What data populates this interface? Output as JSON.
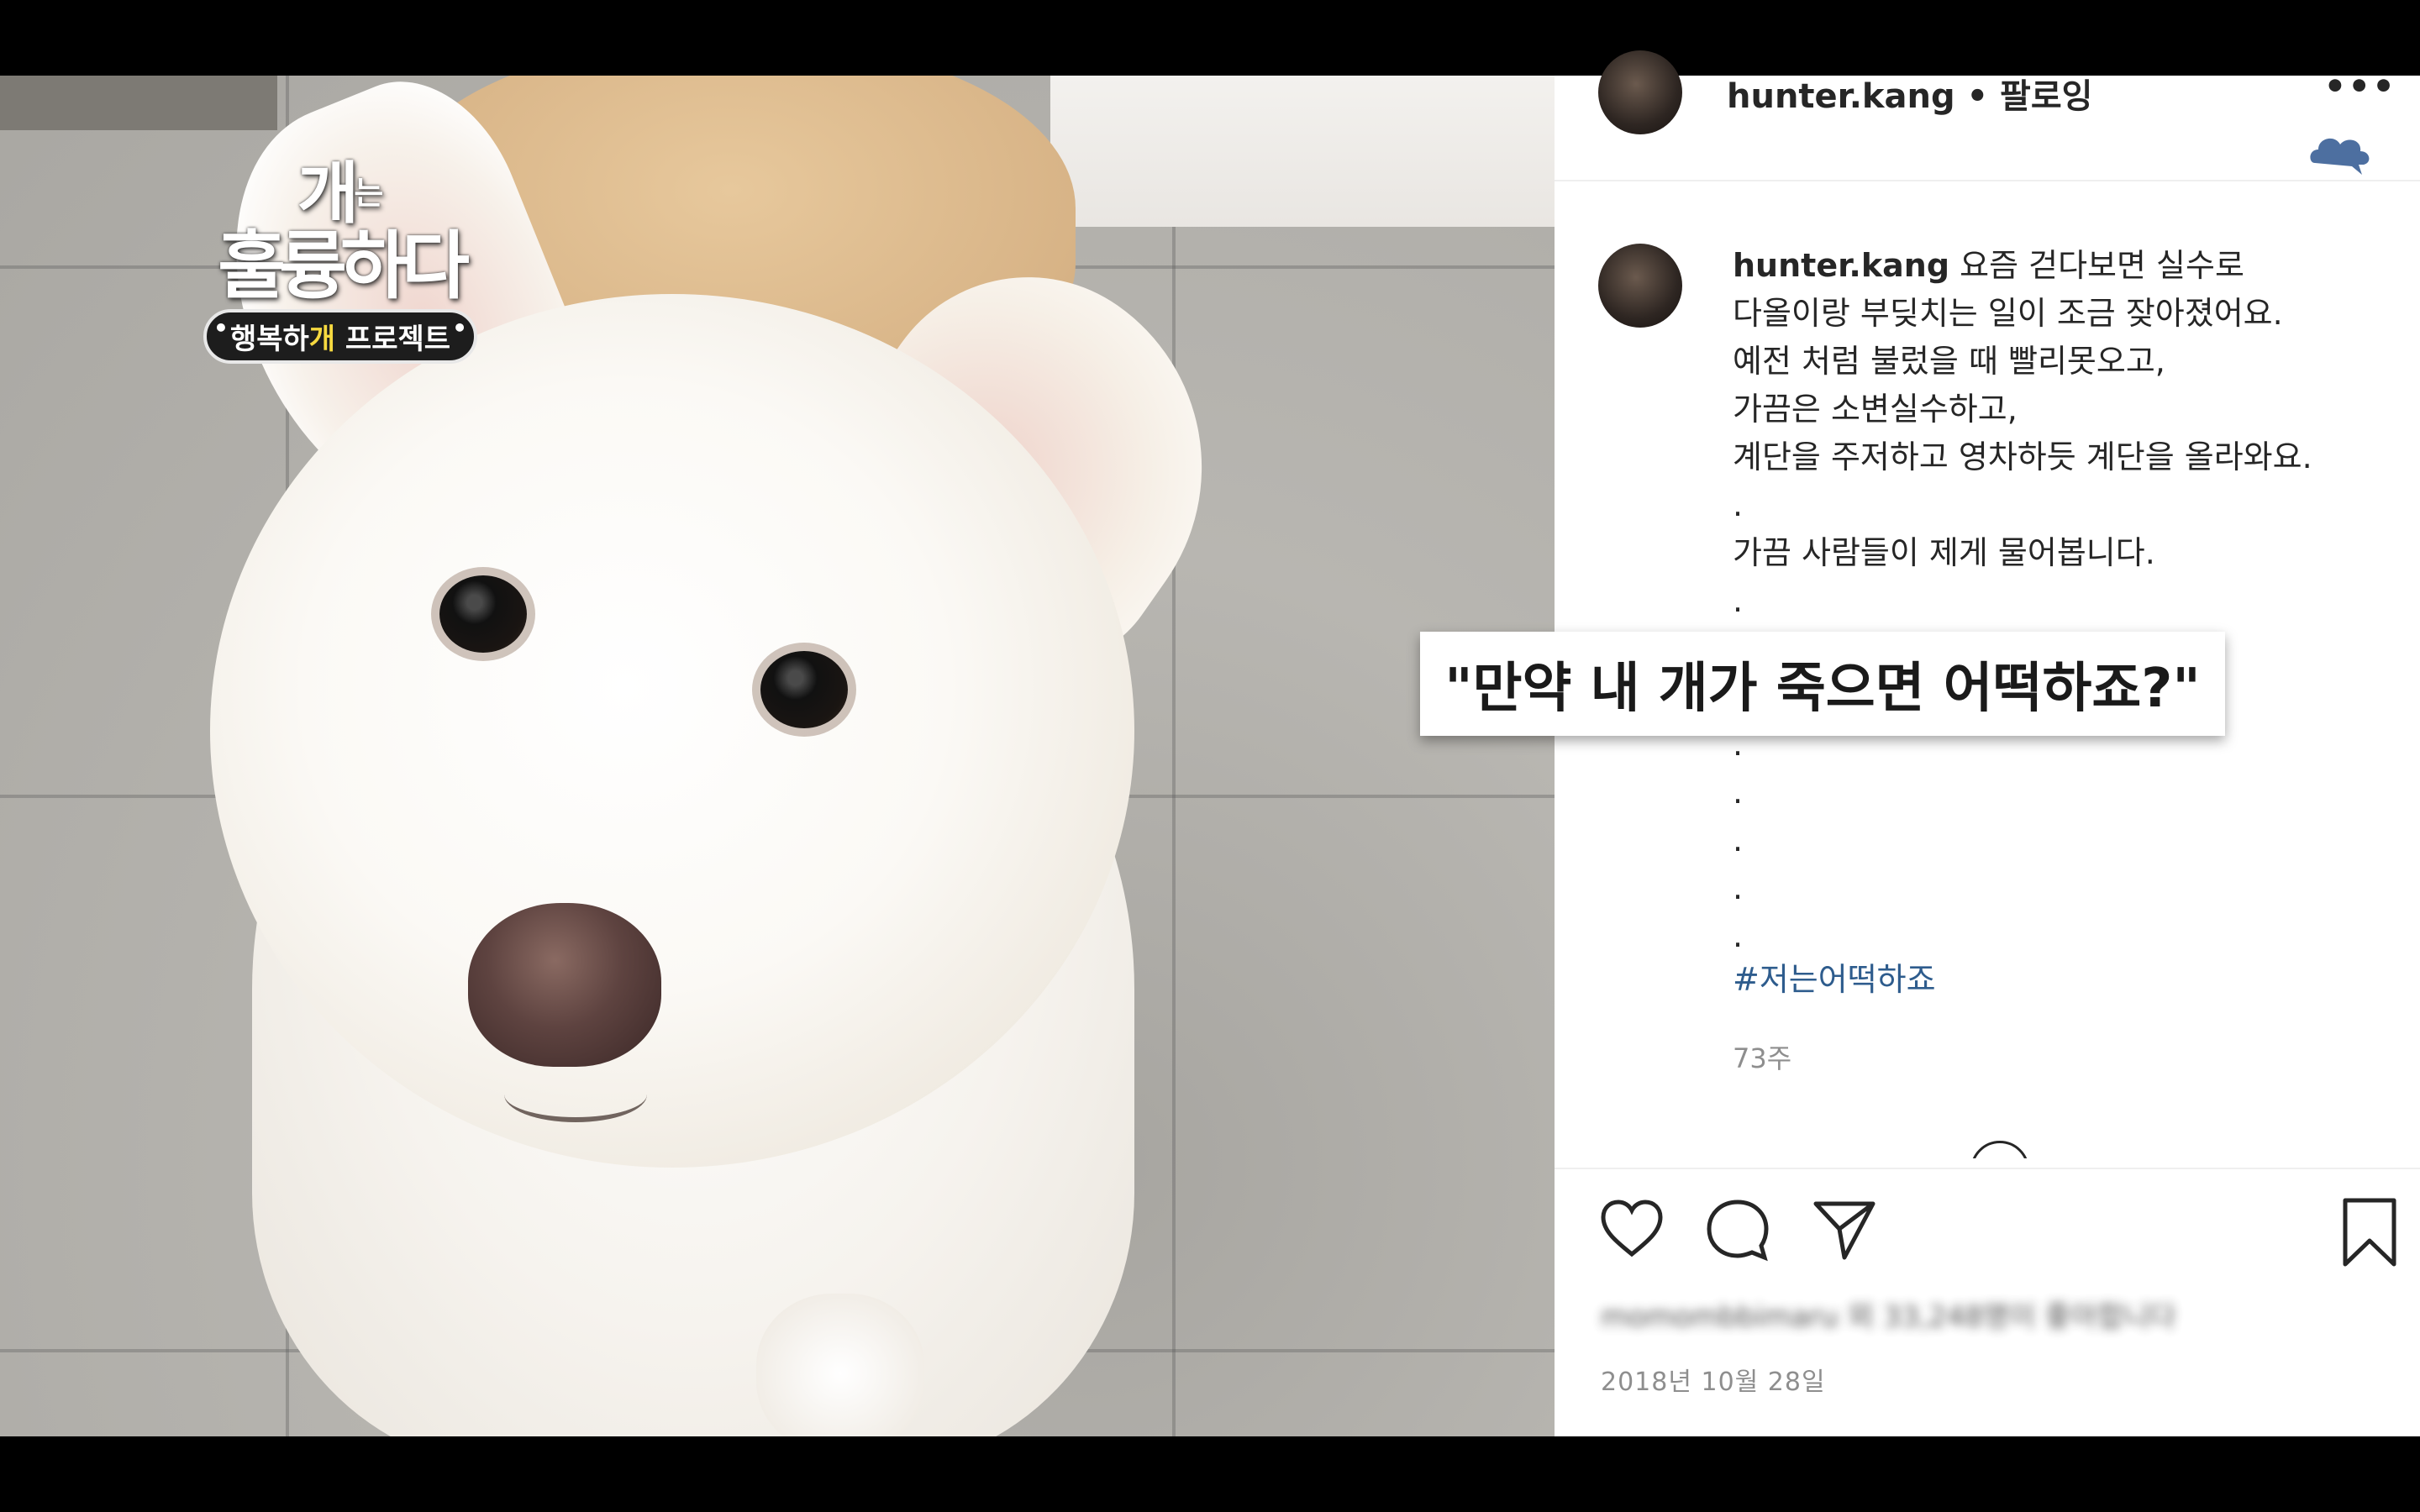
{
  "show": {
    "title_line1": "개",
    "title_small": "는",
    "title_line2": "훌륭하다",
    "subtitle_pre": "행복하",
    "subtitle_highlight": "개",
    "subtitle_post": " 프로젝트"
  },
  "post": {
    "header_username": "hunter.kang",
    "header_follow": " • 팔로잉",
    "more_label": "•••",
    "caption_username": "hunter.kang",
    "caption_lines": [
      " 요즘 걷다보면 실수로",
      "다올이랑 부딪치는 일이 조금 잦아졌어요.",
      "예전 처럼 불렀을 때 빨리못오고,",
      "가끔은 소변실수하고,",
      "계단을 주저하고 영차하듯 계단을 올라와요.",
      ".",
      "가끔 사람들이 제게 물어봅니다.",
      ".",
      ".",
      ".",
      ".",
      ".",
      ".",
      ".",
      "."
    ],
    "hashtag": "#저는어떡하죠",
    "ago": "73주",
    "likes_blurred": "momombbimaru 외 33,248명이 좋아합니다",
    "date": "2018년 10월 28일"
  },
  "overlay": {
    "subtitle": "\"만약 내 개가 죽으면 어떡하죠?\""
  },
  "colors": {
    "hashtag": "#2e5c8d",
    "meta_gray": "#8e8e8e",
    "text": "#262626",
    "letterbox": "#000000"
  }
}
